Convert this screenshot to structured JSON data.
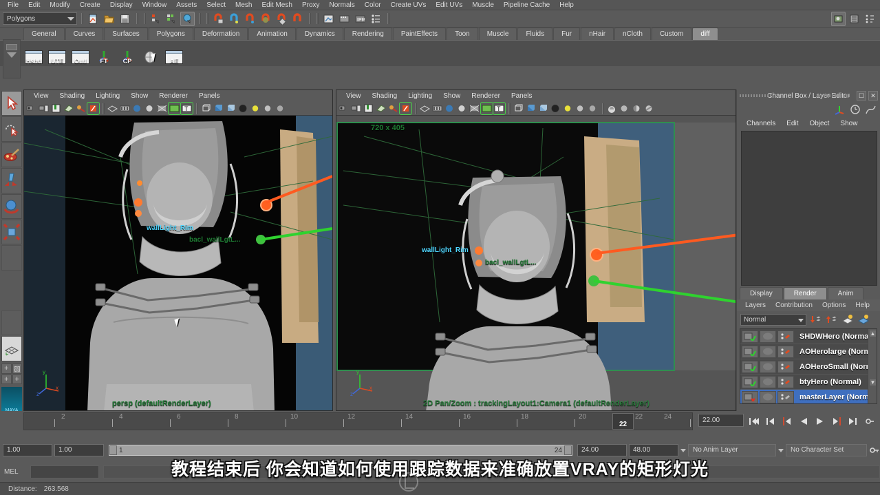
{
  "menubar": {
    "items": [
      "File",
      "Edit",
      "Modify",
      "Create",
      "Display",
      "Window",
      "Assets",
      "Select",
      "Mesh",
      "Edit Mesh",
      "Proxy",
      "Normals",
      "Color",
      "Create UVs",
      "Edit UVs",
      "Muscle",
      "Pipeline Cache",
      "Help"
    ]
  },
  "statusline": {
    "menuset": "Polygons"
  },
  "shelf": {
    "tabs": [
      "General",
      "Curves",
      "Surfaces",
      "Polygons",
      "Deformation",
      "Animation",
      "Dynamics",
      "Rendering",
      "PaintEffects",
      "Toon",
      "Muscle",
      "Fluids",
      "Fur",
      "nHair",
      "nCloth",
      "Custom",
      "diff"
    ],
    "active_tab": "diff",
    "buttons": [
      "Hshd",
      "UTE",
      "Outl",
      "FT",
      "CP",
      "",
      "AE"
    ]
  },
  "viewport_left": {
    "menus": [
      "View",
      "Shading",
      "Lighting",
      "Show",
      "Renderer",
      "Panels"
    ],
    "label_wall_light": "wallLight_Rim",
    "label_back_light": "bacl_wallLgtL...",
    "status": "persp (defaultRenderLayer)",
    "axis_y": "y",
    "axis_x": "x",
    "axis_z": "z"
  },
  "viewport_right": {
    "menus": [
      "View",
      "Shading",
      "Lighting",
      "Show",
      "Renderer",
      "Panels"
    ],
    "resolution": "720 x 405",
    "label_wall_light": "wallLight_Rim",
    "label_back_light": "bacl_wallLgtL...",
    "status": "2D Pan/Zoom : trackingLayout1:Camera1 (defaultRenderLayer)",
    "axis_y": "y",
    "axis_x": "x",
    "axis_z": "z"
  },
  "channelbox": {
    "title": "Channel Box / Layer Editor",
    "menus": [
      "Channels",
      "Edit",
      "Object",
      "Show"
    ]
  },
  "layer_editor": {
    "tabs": [
      "Display",
      "Render",
      "Anim"
    ],
    "active_tab": "Render",
    "menus": [
      "Layers",
      "Contribution",
      "Options",
      "Help"
    ],
    "mode": "Normal",
    "layers": [
      {
        "name": "SHDWHero (Normal)",
        "renderable": true,
        "selected": false
      },
      {
        "name": "AOHerolarge (Norma",
        "renderable": true,
        "selected": false
      },
      {
        "name": "AOHeroSmall (Norm",
        "renderable": true,
        "selected": false
      },
      {
        "name": "btyHero (Normal)",
        "renderable": true,
        "selected": false
      },
      {
        "name": "masterLayer (Norma",
        "renderable": false,
        "selected": true
      }
    ]
  },
  "timeslider": {
    "ticks": [
      "2",
      "4",
      "6",
      "8",
      "10",
      "12",
      "14",
      "16",
      "18",
      "20",
      "22",
      "24"
    ],
    "current_frame": "22",
    "current_frame_field": "22.00"
  },
  "rangeslider": {
    "field_left_1": "1.00",
    "field_left_2": "1.00",
    "range_start": "1",
    "range_end": "24",
    "field_right_1": "24.00",
    "field_right_2": "48.00",
    "anim_layer": "No Anim Layer",
    "character_set": "No Character Set"
  },
  "commandline": {
    "label": "MEL",
    "input_value": ""
  },
  "helpline": {
    "distance_label": "Distance:",
    "distance_value": "263.568"
  },
  "subtitle": {
    "text": "教程结束后 你会知道如何使用跟踪数据来准确放置VRAY的矩形灯光"
  },
  "colors": {
    "bg": "#5a5a5a",
    "selection_blue": "#3f6fbf",
    "accent_green": "#49d049",
    "light_cyan": "#3fd0ff",
    "light_orange": "#ff5a20"
  }
}
